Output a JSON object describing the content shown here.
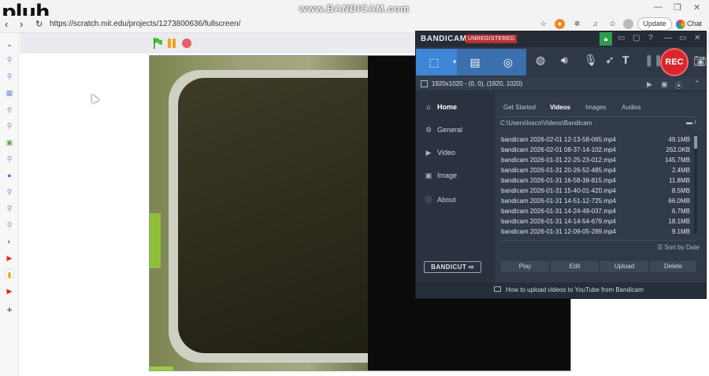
{
  "watermark": {
    "text": "pluh",
    "recorder": "www.BANDICAM.com"
  },
  "browser": {
    "url": "https://scratch.mit.edu/projects/1273800636/fullscreen/",
    "update_label": "Update",
    "chat_label": "Chat"
  },
  "bandicam": {
    "brand": "BANDICAM",
    "unregistered": "UNREGISTERED",
    "rec_label": "REC",
    "resolution": "1920x1020 - (0, 0), (1920, 1020)",
    "nav": [
      {
        "label": "Home"
      },
      {
        "label": "General"
      },
      {
        "label": "Video"
      },
      {
        "label": "Image"
      },
      {
        "label": "About"
      }
    ],
    "tabs": [
      {
        "label": "Get Started"
      },
      {
        "label": "Videos"
      },
      {
        "label": "Images"
      },
      {
        "label": "Audios"
      }
    ],
    "path": "C:\\Users\\losco\\Videos\\Bandicam",
    "files": [
      {
        "name": "bandicam 2026-02-01 12-13-58-065.mp4",
        "size": "49.1MB"
      },
      {
        "name": "bandicam 2026-02-01 08-37-14-102.mp4",
        "size": "262.0KB"
      },
      {
        "name": "bandicam 2026-01-31 22-25-23-012.mp4",
        "size": "145.7MB"
      },
      {
        "name": "bandicam 2026-01-31 20-26-52-485.mp4",
        "size": "2.4MB"
      },
      {
        "name": "bandicam 2026-01-31 16-58-38-815.mp4",
        "size": "11.8MB"
      },
      {
        "name": "bandicam 2026-01-31 15-40-01-420.mp4",
        "size": "8.5MB"
      },
      {
        "name": "bandicam 2026-01-31 14-51-12-725.mp4",
        "size": "66.0MB"
      },
      {
        "name": "bandicam 2026-01-31 14-24-49-037.mp4",
        "size": "6.7MB"
      },
      {
        "name": "bandicam 2026-01-31 14-14-54-679.mp4",
        "size": "18.1MB"
      },
      {
        "name": "bandicam 2026-01-31 12-09-05-289.mp4",
        "size": "9.1MB"
      }
    ],
    "sort_label": "Sort by Date",
    "bandicut_label": "BANDICUT",
    "actions": [
      {
        "label": "Play"
      },
      {
        "label": "Edit"
      },
      {
        "label": "Upload"
      },
      {
        "label": "Delete"
      }
    ],
    "footer": "How to upload videos to YouTube from Bandicam"
  }
}
